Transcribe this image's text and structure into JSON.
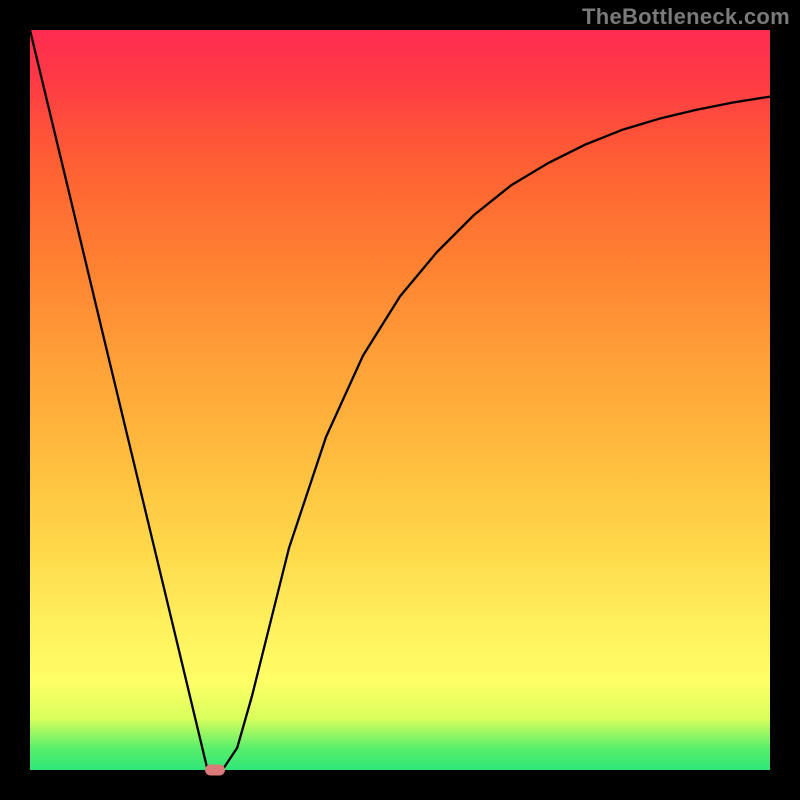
{
  "watermark": "TheBottleneck.com",
  "colors": {
    "frame": "#000000",
    "curve_stroke": "#000000",
    "marker": "#db7b79",
    "watermark_text": "#7a7a7a"
  },
  "chart_data": {
    "type": "line",
    "title": "",
    "xlabel": "",
    "ylabel": "",
    "xlim": [
      0,
      100
    ],
    "ylim": [
      0,
      100
    ],
    "grid": false,
    "legend": false,
    "x": [
      0,
      5,
      10,
      15,
      20,
      24,
      26,
      28,
      30,
      35,
      40,
      45,
      50,
      55,
      60,
      65,
      70,
      75,
      80,
      85,
      90,
      95,
      100
    ],
    "values": [
      100,
      79.2,
      58.3,
      37.5,
      16.7,
      0,
      0,
      3,
      10,
      30,
      45,
      56,
      64,
      70,
      75,
      79,
      82,
      84.5,
      86.5,
      88,
      89.2,
      90.2,
      91
    ],
    "min_marker": {
      "x": 25,
      "y": 0
    },
    "background_gradient_stops": [
      {
        "pct": 0,
        "color": "#2ee67a"
      },
      {
        "pct": 3,
        "color": "#5aef6a"
      },
      {
        "pct": 7,
        "color": "#d9ff5c"
      },
      {
        "pct": 12,
        "color": "#ffff66"
      },
      {
        "pct": 20,
        "color": "#ffef5c"
      },
      {
        "pct": 30,
        "color": "#ffd84a"
      },
      {
        "pct": 42,
        "color": "#ffbd3e"
      },
      {
        "pct": 55,
        "color": "#ffa138"
      },
      {
        "pct": 68,
        "color": "#ff8232"
      },
      {
        "pct": 82,
        "color": "#ff5f33"
      },
      {
        "pct": 93,
        "color": "#ff3b44"
      },
      {
        "pct": 100,
        "color": "#ff2c52"
      }
    ]
  }
}
